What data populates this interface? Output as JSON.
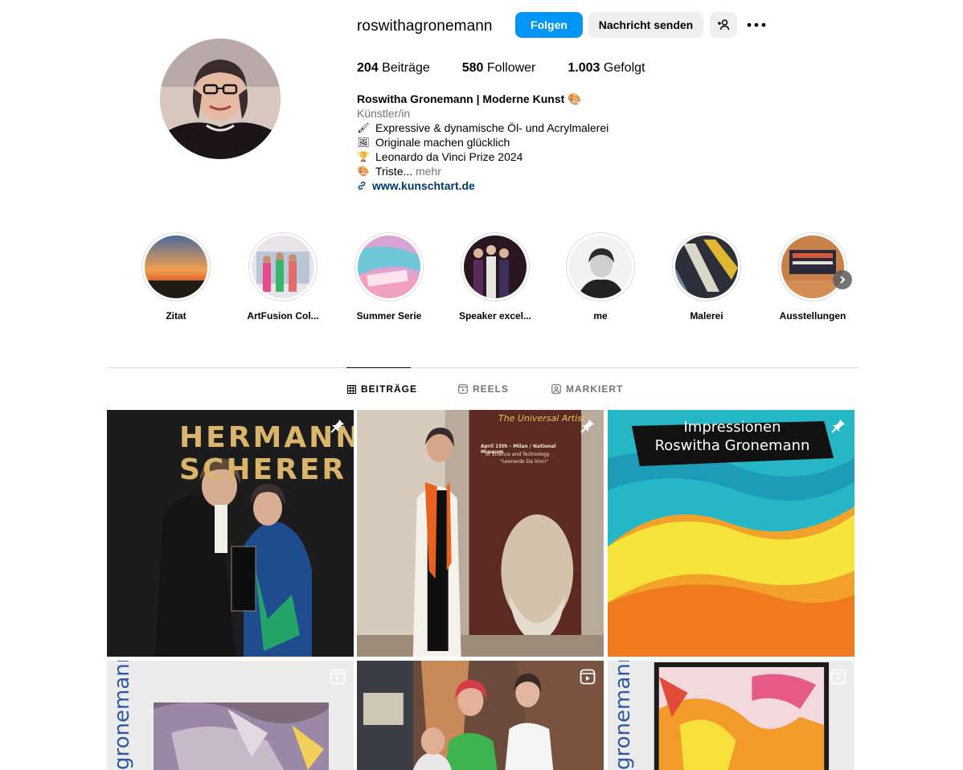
{
  "profile": {
    "username": "roswithagronemann",
    "follow_label": "Folgen",
    "message_label": "Nachricht senden",
    "stats": [
      {
        "count": "204",
        "label": "Beiträge"
      },
      {
        "count": "580",
        "label": "Follower"
      },
      {
        "count": "1.003",
        "label": "Gefolgt"
      }
    ],
    "name": "Roswitha Gronemann | Moderne Kunst 🎨",
    "category": "Künstler/in",
    "bio_lines": [
      {
        "emoji": "🖌",
        "text": "Expressive & dynamische Öl- und Acrylmalerei"
      },
      {
        "emoji": "🖼",
        "text": "Originale machen glücklich"
      },
      {
        "emoji": "🏆",
        "text": "Leonardo da Vinci Prize 2024"
      },
      {
        "emoji": "🎨",
        "text": "Triste..."
      }
    ],
    "more_label": "mehr",
    "website": "www.kunschtart.de"
  },
  "highlights": [
    {
      "label": "Zitat"
    },
    {
      "label": "ArtFusion Col..."
    },
    {
      "label": "Summer Serie"
    },
    {
      "label": "Speaker excel..."
    },
    {
      "label": "me"
    },
    {
      "label": "Malerei"
    },
    {
      "label": "Ausstellungen"
    }
  ],
  "tabs": [
    {
      "label": "BEITRÄGE",
      "active": true
    },
    {
      "label": "REELS",
      "active": false
    },
    {
      "label": "MARKIERT",
      "active": false
    }
  ],
  "posts": [
    {
      "type": "pinned",
      "text_lines": [
        "HERMANN",
        "SCHERER"
      ]
    },
    {
      "type": "pinned",
      "text_lines": [
        "The Universal Artist",
        "April 15th - Milan / National Museum",
        "of Science and Technology",
        "\"Leonardo Da Vinci\""
      ]
    },
    {
      "type": "pinned",
      "text_lines": [
        "Impressionen",
        "Roswitha Gronemann"
      ]
    },
    {
      "type": "reel",
      "text_lines": [
        "gronemann"
      ]
    },
    {
      "type": "reel",
      "text_lines": []
    },
    {
      "type": "reel",
      "text_lines": [
        "gronemann"
      ]
    }
  ],
  "colors": {
    "accent": "#0095f6",
    "button_gray": "#efefef",
    "secondary_text": "#737373",
    "link": "#00376b",
    "border": "#dbdbdb"
  }
}
